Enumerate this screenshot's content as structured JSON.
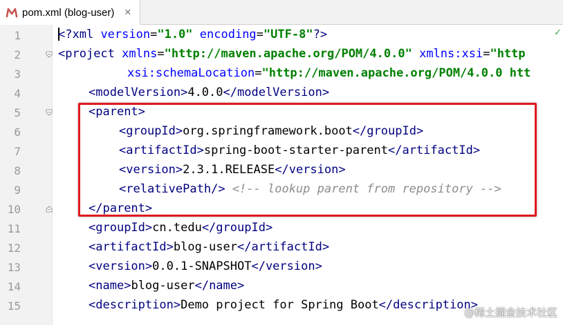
{
  "tab": {
    "label": "pom.xml (blog-user)",
    "icon": "maven-icon",
    "accent": "#c75450"
  },
  "line_numbers": [
    "1",
    "2",
    "3",
    "4",
    "5",
    "6",
    "7",
    "8",
    "9",
    "10",
    "11",
    "12",
    "13",
    "14",
    "15"
  ],
  "code": {
    "l1": {
      "p1": "?xml ",
      "a1": "version",
      "eq1": "=",
      "v1": "\"1.0\"",
      "sp": " ",
      "a2": "encoding",
      "eq2": "=",
      "v2": "\"UTF-8\"",
      "p2": "?>"
    },
    "l2": {
      "open": "<",
      "tag": "project",
      "sp1": " ",
      "a1": "xmlns",
      "eq1": "=",
      "v1": "\"http://maven.apache.org/POM/4.0.0\"",
      "sp2": " ",
      "a2": "xmlns:xsi",
      "eq2": "=",
      "v2": "\"http"
    },
    "l3": {
      "a1": "xsi:schemaLocation",
      "eq1": "=",
      "v1": "\"http://maven.apache.org/POM/4.0.0 htt"
    },
    "l4": {
      "o1": "<",
      "t1": "modelVersion",
      "c1": ">",
      "text": "4.0.0",
      "o2": "</",
      "t2": "modelVersion",
      "c2": ">"
    },
    "l5": {
      "o1": "<",
      "t1": "parent",
      "c1": ">"
    },
    "l6": {
      "o1": "<",
      "t1": "groupId",
      "c1": ">",
      "text": "org.springframework.boot",
      "o2": "</",
      "t2": "groupId",
      "c2": ">"
    },
    "l7": {
      "o1": "<",
      "t1": "artifactId",
      "c1": ">",
      "text": "spring-boot-starter-parent",
      "o2": "</",
      "t2": "artifactId",
      "c2": ">"
    },
    "l8": {
      "o1": "<",
      "t1": "version",
      "c1": ">",
      "text": "2.3.1.RELEASE",
      "o2": "</",
      "t2": "version",
      "c2": ">"
    },
    "l9": {
      "o1": "<",
      "t1": "relativePath",
      "c1": "/>",
      "sp": " ",
      "comment": "<!-- lookup parent from repository -->"
    },
    "l10": {
      "o1": "</",
      "t1": "parent",
      "c1": ">"
    },
    "l11": {
      "o1": "<",
      "t1": "groupId",
      "c1": ">",
      "text": "cn.tedu",
      "o2": "</",
      "t2": "groupId",
      "c2": ">"
    },
    "l12": {
      "o1": "<",
      "t1": "artifactId",
      "c1": ">",
      "text": "blog-user",
      "o2": "</",
      "t2": "artifactId",
      "c2": ">"
    },
    "l13": {
      "o1": "<",
      "t1": "version",
      "c1": ">",
      "text": "0.0.1-SNAPSHOT",
      "o2": "</",
      "t2": "version",
      "c2": ">"
    },
    "l14": {
      "o1": "<",
      "t1": "name",
      "c1": ">",
      "text": "blog-user",
      "o2": "</",
      "t2": "name",
      "c2": ">"
    },
    "l15": {
      "o1": "<",
      "t1": "description",
      "c1": ">",
      "text": "Demo project for Spring Boot",
      "o2": "</",
      "t2": "description",
      "c2": ">"
    }
  },
  "watermark": "@稀土掘金技术社区",
  "colors": {
    "tag": "#000080",
    "attr": "#0000ff",
    "value": "#008000",
    "comment": "#8c8c8c",
    "highlight": "#e0191e"
  }
}
